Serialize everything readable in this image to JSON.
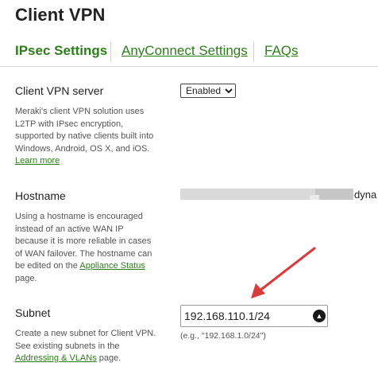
{
  "page": {
    "title": "Client VPN"
  },
  "tabs": [
    {
      "label": "IPsec Settings"
    },
    {
      "label": "AnyConnect Settings"
    },
    {
      "label": "FAQs"
    }
  ],
  "client_vpn_server": {
    "label": "Client VPN server",
    "selected_option": "Enabled",
    "help_text": "Meraki's client VPN solution uses L2TP with IPsec encryption, supported by native clients built into Windows, Android, OS X, and iOS.",
    "help_link": "Learn more"
  },
  "hostname": {
    "label": "Hostname",
    "value_suffix": "dyna",
    "help_text_1": "Using a hostname is encouraged instead of an active WAN IP because it is more reliable in cases of WAN failover. The hostname can be edited on the",
    "help_link": "Appliance Status",
    "help_text_2": "page."
  },
  "subnet": {
    "label": "Subnet",
    "value": "192.168.110.1/24",
    "example": "(e.g., \"192.168.1.0/24\")",
    "help_text_1": "Create a new subnet for Client VPN. See existing subnets in the",
    "help_link": "Addressing & VLANs",
    "help_text_2": "page."
  },
  "colors": {
    "accent": "#2e7d1b",
    "annotation_arrow": "#d93a3a"
  },
  "icons": {
    "subnet_field_icon": "password-manager-icon"
  }
}
